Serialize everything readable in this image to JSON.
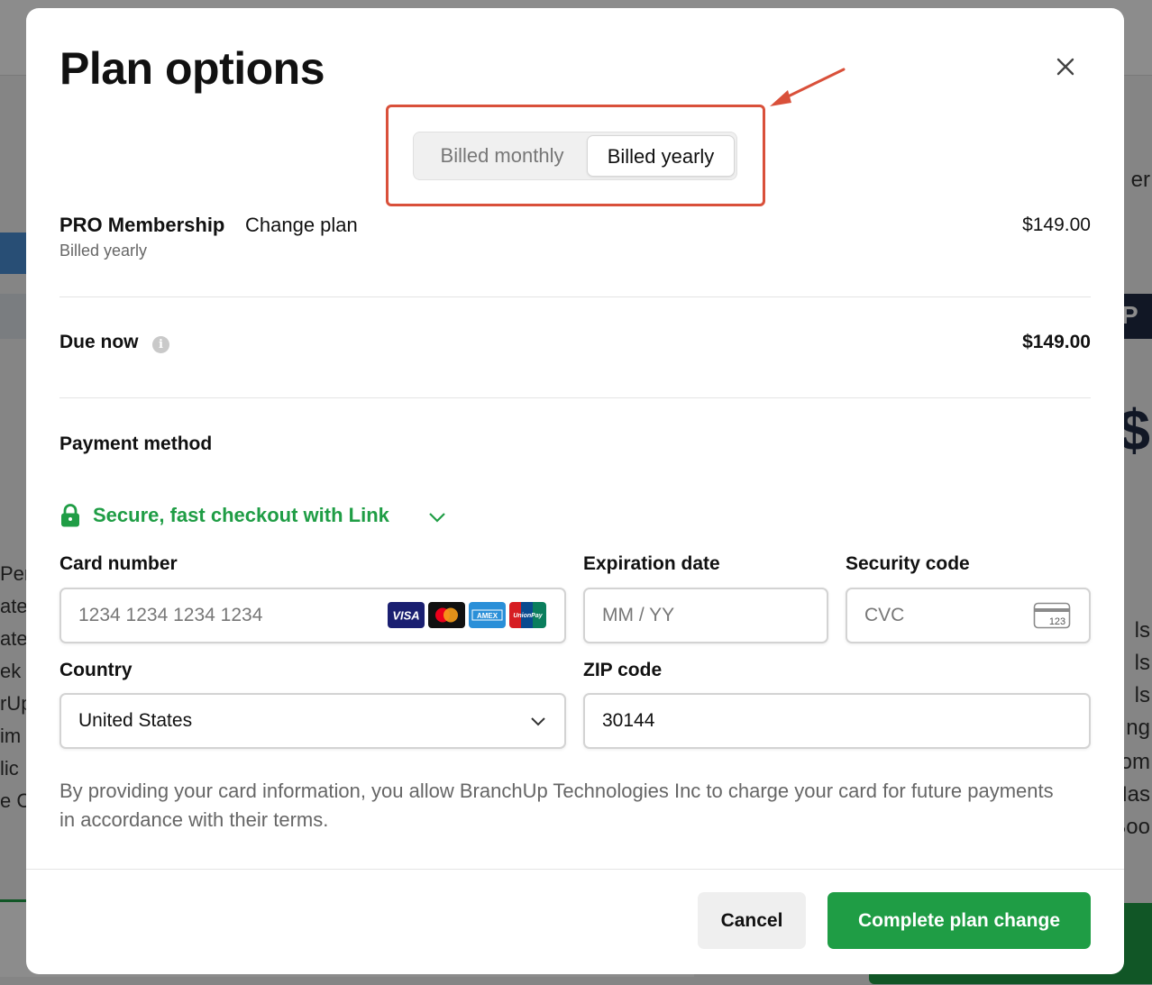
{
  "modal": {
    "title": "Plan options",
    "close_icon": "close-icon"
  },
  "billing_toggle": {
    "monthly_label": "Billed monthly",
    "yearly_label": "Billed yearly",
    "selected": "yearly"
  },
  "plan": {
    "name": "PRO Membership",
    "change_label": "Change plan",
    "billing": "Billed yearly",
    "price": "$149.00"
  },
  "due": {
    "label": "Due now",
    "amount": "$149.00",
    "info_icon": "info-icon"
  },
  "payment": {
    "title": "Payment method",
    "link_text": "Secure, fast checkout with Link",
    "card_number": {
      "label": "Card number",
      "placeholder": "1234 1234 1234 1234"
    },
    "card_brands": [
      "VISA",
      "Mastercard",
      "AMEX",
      "UnionPay"
    ],
    "expiration": {
      "label": "Expiration date",
      "placeholder": "MM / YY"
    },
    "security": {
      "label": "Security code",
      "placeholder": "CVC",
      "icon_text": "123"
    },
    "country": {
      "label": "Country",
      "value": "United States"
    },
    "zip": {
      "label": "ZIP code",
      "value": "30144"
    },
    "terms": "By providing your card information, you allow BranchUp Technologies Inc to charge your card for future payments in accordance with their terms."
  },
  "footer": {
    "cancel_label": "Cancel",
    "complete_label": "Complete plan change"
  },
  "colors": {
    "accent_green": "#1f9d45",
    "annotation_red": "#d9503a"
  }
}
